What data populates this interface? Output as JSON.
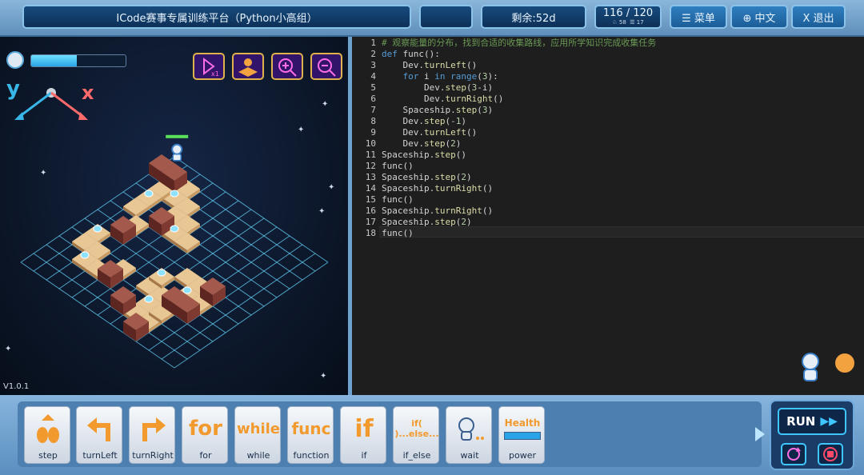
{
  "header": {
    "title": "ICode赛事专属训练平台（Python小高组）",
    "remaining": "剩余:52d",
    "score_main": "116 / 120",
    "score_sub_a": "58",
    "score_sub_b": "17",
    "menu_label": "☰ 菜单",
    "lang_label": "⊕ 中文",
    "exit_label": "X 退出"
  },
  "scene": {
    "axis_y": "y",
    "axis_x": "x",
    "version": "V1.0.1",
    "controls": [
      "play-speed-x1-icon",
      "grid-view-icon",
      "zoom-in-icon",
      "zoom-out-icon"
    ]
  },
  "editor": {
    "line_numbers": [
      "1",
      "2",
      "3",
      "4",
      "5",
      "6",
      "7",
      "8",
      "9",
      "10",
      "11",
      "12",
      "13",
      "14",
      "15",
      "16",
      "17",
      "18"
    ],
    "lines": [
      "# 观察能量的分布，找到合适的收集路线，应用所学知识完成收集任务",
      "def func():",
      "    Dev.turnLeft()",
      "    for i in range(3):",
      "        Dev.step(3-i)",
      "        Dev.turnRight()",
      "    Spaceship.step(3)",
      "    Dev.step(-1)",
      "    Dev.turnLeft()",
      "    Dev.step(2)",
      "Spaceship.step()",
      "func()",
      "Spaceship.step(2)",
      "Spaceship.turnRight()",
      "func()",
      "Spaceship.turnRight()",
      "Spaceship.step(2)",
      "func()"
    ]
  },
  "palette": {
    "blocks": [
      {
        "name": "step",
        "art": "",
        "label": "step"
      },
      {
        "name": "turnLeft",
        "art": "",
        "label": "turnLeft"
      },
      {
        "name": "turnRight",
        "art": "",
        "label": "turnRight"
      },
      {
        "name": "for",
        "art": "for",
        "label": "for"
      },
      {
        "name": "while",
        "art": "while",
        "label": "while"
      },
      {
        "name": "function",
        "art": "func",
        "label": "function"
      },
      {
        "name": "if",
        "art": "if",
        "label": "if"
      },
      {
        "name": "if_else",
        "art": "if( )...else...",
        "label": "if_else"
      },
      {
        "name": "wait",
        "art": "",
        "label": "wait"
      },
      {
        "name": "power",
        "art": "Health",
        "label": "power"
      }
    ]
  },
  "run": {
    "label": "RUN"
  },
  "colors": {
    "accent": "#3fc6ff",
    "block_orange": "#f29a2e",
    "axis_y": "#39b6e8",
    "axis_x": "#ff6a6a"
  },
  "progress": {
    "energy_fill": 0.48
  }
}
